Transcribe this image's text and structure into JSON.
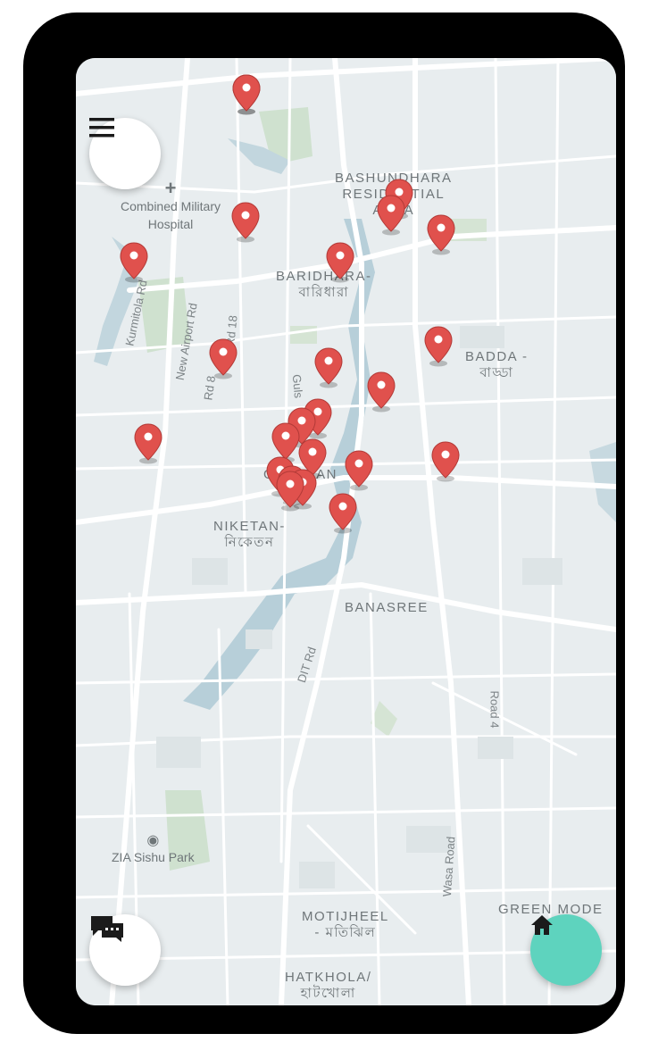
{
  "map": {
    "area_labels": [
      {
        "id": "bashundhara",
        "lines": [
          "BASHUNDHARA",
          "RESIDENTIAL",
          "AREA"
        ]
      },
      {
        "id": "baridhara",
        "lines": [
          "BARIDHARA-",
          "বারিধারা"
        ]
      },
      {
        "id": "badda",
        "lines": [
          "BADDA -",
          "বাড্ডা"
        ]
      },
      {
        "id": "gulshan",
        "lines": [
          "GULSHAN"
        ]
      },
      {
        "id": "niketan",
        "lines": [
          "NIKETAN-",
          "নিকেতন"
        ]
      },
      {
        "id": "banasree",
        "lines": [
          "BANASREE"
        ]
      },
      {
        "id": "motijheel",
        "lines": [
          "MOTIJHEEL",
          "- মতিঝিল"
        ]
      },
      {
        "id": "hatkhola",
        "lines": [
          "HATKHOLA/",
          "হাটখোলা"
        ]
      },
      {
        "id": "green-model",
        "lines": [
          "GREEN MODE"
        ]
      }
    ],
    "poi_labels": {
      "hospital": "Combined Military Hospital",
      "park": "ZIA Sishu Park"
    },
    "road_labels": {
      "kurmitola": "Kurmitola Rd",
      "new_airport": "New Airport Rd",
      "rd8": "Rd 8",
      "rd18": "Rd 18",
      "guls": "Guls",
      "dit": "DIT Rd",
      "road4": "Road 4",
      "wasa": "Wasa Road"
    },
    "marker_count": 24
  },
  "controls": {
    "menu": "hamburger-menu-icon",
    "chat": "chat-bubbles-icon",
    "home": "home-icon",
    "home_color": "#5ed3be",
    "marker_color": "#e0514d"
  }
}
